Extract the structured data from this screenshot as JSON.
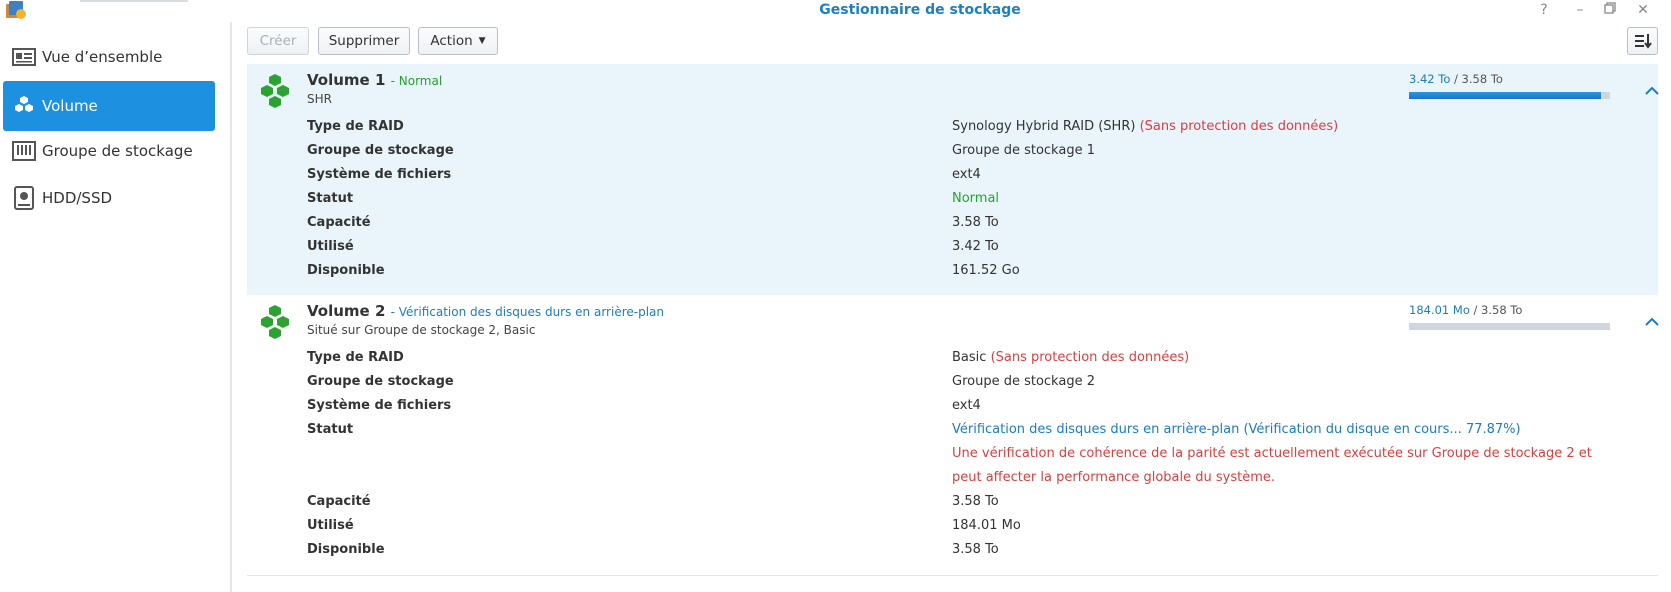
{
  "window": {
    "title": "Gestionnaire de stockage",
    "controls": [
      "help-icon",
      "minimize-icon",
      "restore-icon",
      "close-icon"
    ]
  },
  "sidebar": {
    "items": [
      {
        "label": "Vue d’ensemble",
        "icon": "overview-icon",
        "active": false
      },
      {
        "label": "Volume",
        "icon": "volume-cubes-icon",
        "active": true
      },
      {
        "label": "Groupe de stockage",
        "icon": "storage-pool-icon",
        "active": false
      },
      {
        "label": "HDD/SSD",
        "icon": "hdd-icon",
        "active": false
      }
    ]
  },
  "toolbar": {
    "create_label": "Créer",
    "delete_label": "Supprimer",
    "action_label": "Action",
    "sort_icon": "sort-icon"
  },
  "colors": {
    "accent": "#1e90e0",
    "normal": "#23a32b",
    "warning": "#e03c3c",
    "info": "#1b7cc2",
    "selected_row": "#e9f5fb"
  },
  "volumes": [
    {
      "name": "Volume 1",
      "status_inline": "- Normal",
      "subtitle": "SHR",
      "usage_used": "3.42 To",
      "usage_total": " / 3.58 To",
      "usage_fraction": 0.955,
      "rows": {
        "raid_label": "Type de RAID",
        "raid_value": "Synology Hybrid RAID (SHR)",
        "raid_note": "(Sans protection des données)",
        "pool_label": "Groupe de stockage",
        "pool_value": "Groupe de stockage 1",
        "fs_label": "Système de fichiers",
        "fs_value": "ext4",
        "status_label": "Statut",
        "status_value": "Normal",
        "capacity_label": "Capacité",
        "capacity_value": "3.58 To",
        "used_label": "Utilisé",
        "used_value": "3.42 To",
        "available_label": "Disponible",
        "available_value": "161.52 Go"
      }
    },
    {
      "name": "Volume 2",
      "status_inline": "- Vérification des disques durs en arrière-plan",
      "subtitle": "Situé sur Groupe de stockage 2, Basic",
      "usage_used": "184.01 Mo",
      "usage_total": " / 3.58 To",
      "usage_fraction": 0.0,
      "rows": {
        "raid_label": "Type de RAID",
        "raid_value": "Basic",
        "raid_note": "(Sans protection des données)",
        "pool_label": "Groupe de stockage",
        "pool_value": "Groupe de stockage 2",
        "fs_label": "Système de fichiers",
        "fs_value": "ext4",
        "status_label": "Statut",
        "status_value": "Vérification des disques durs en arrière-plan (Vérification du disque en cours... 77.87%)",
        "warning_line1": "Une vérification de cohérence de la parité est actuellement exécutée sur Groupe de stockage 2 et",
        "warning_line2": "peut affecter la performance globale du système.",
        "capacity_label": "Capacité",
        "capacity_value": "3.58 To",
        "used_label": "Utilisé",
        "used_value": "184.01 Mo",
        "available_label": "Disponible",
        "available_value": "3.58 To"
      }
    }
  ]
}
